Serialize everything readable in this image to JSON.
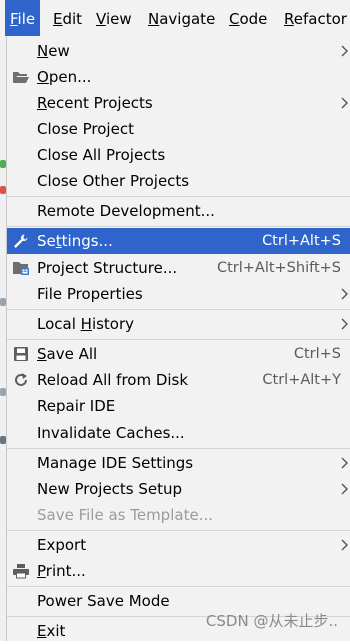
{
  "menubar": {
    "items": [
      {
        "mnemonic": "F",
        "rest": "ile"
      },
      {
        "mnemonic": "E",
        "rest": "dit"
      },
      {
        "mnemonic": "V",
        "rest": "iew"
      },
      {
        "mnemonic": "N",
        "rest": "avigate"
      },
      {
        "mnemonic": "C",
        "rest": "ode"
      },
      {
        "mnemonic": "R",
        "rest": "efactor"
      }
    ]
  },
  "file_menu": {
    "new": {
      "mn": "N",
      "rest": "ew"
    },
    "open": {
      "mn": "O",
      "rest": "pen..."
    },
    "recent_projects": {
      "mn": "R",
      "rest": "ecent Projects"
    },
    "close_project": "Close Project",
    "close_all_projects": "Close All Projects",
    "close_other_projects": "Close Other Projects",
    "remote_development": "Remote Development...",
    "settings": {
      "pre": "Se",
      "mn": "t",
      "rest": "tings...",
      "shortcut": "Ctrl+Alt+S"
    },
    "project_structure": {
      "label": "Project Structure...",
      "shortcut": "Ctrl+Alt+Shift+S"
    },
    "file_properties": "File Properties",
    "local_history": {
      "pre": "Local ",
      "mn": "H",
      "rest": "istory"
    },
    "save_all": {
      "mn": "S",
      "rest": "ave All",
      "shortcut": "Ctrl+S"
    },
    "reload_all": {
      "label": "Reload All from Disk",
      "shortcut": "Ctrl+Alt+Y"
    },
    "repair_ide": "Repair IDE",
    "invalidate_caches": "Invalidate Caches...",
    "manage_ide_settings": "Manage IDE Settings",
    "new_projects_setup": "New Projects Setup",
    "save_file_as_template": "Save File as Template...",
    "export": "Export",
    "print": {
      "mn": "P",
      "rest": "rint..."
    },
    "power_save_mode": "Power Save Mode",
    "exit": {
      "mn": "E",
      "rest": "xit"
    }
  },
  "watermark": "CSDN @从未止步..",
  "colors": {
    "selection": "#2f65ca",
    "menu_bg": "#f2f2f2",
    "disabled": "#9b9b9b"
  },
  "icons": [
    "folder-open-icon",
    "wrench-icon",
    "project-structure-icon",
    "save-icon",
    "reload-icon",
    "printer-icon",
    "submenu-arrow-icon"
  ]
}
